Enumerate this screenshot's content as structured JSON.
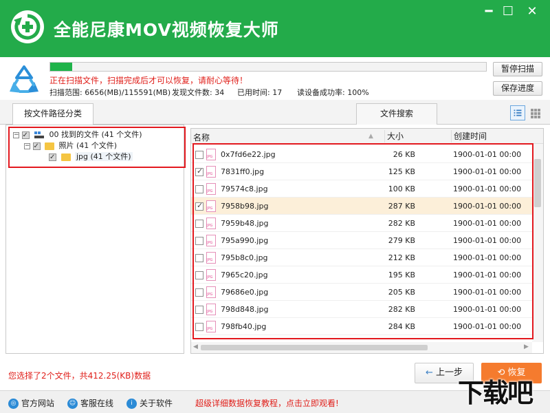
{
  "app": {
    "title": "全能尼康MOV视频恢复大师",
    "window_controls": {
      "minimize": "━",
      "maximize": "☐",
      "close": "✕"
    }
  },
  "scan": {
    "progress": 0.05,
    "status": "正在扫描文件，扫描完成后才可以恢复，请耐心等待！",
    "range": "扫描范围: 6656(MB)/115591(MB)",
    "found": "发现文件数: 34",
    "elapsed": "已用时间: 17",
    "read_rate": "读设备成功率: 100%",
    "pause_label": "暂停扫描",
    "save_label": "保存进度"
  },
  "tabs": {
    "by_path": "按文件路径分类",
    "search": "文件搜索"
  },
  "tree": [
    {
      "label": "00 找到的文件 (41 个文件)"
    },
    {
      "label": "照片   (41 个文件)"
    },
    {
      "label": "jpg   (41 个文件)"
    }
  ],
  "list": {
    "headers": {
      "name": "名称",
      "size": "大小",
      "created": "创建时间"
    },
    "rows": [
      {
        "name": "0x7fd6e22.jpg",
        "size": "26 KB",
        "created": "1900-01-01  00:00",
        "checked": false
      },
      {
        "name": "7831ff0.jpg",
        "size": "125 KB",
        "created": "1900-01-01  00:00",
        "checked": true
      },
      {
        "name": "79574c8.jpg",
        "size": "100 KB",
        "created": "1900-01-01  00:00",
        "checked": false
      },
      {
        "name": "7958b98.jpg",
        "size": "287 KB",
        "created": "1900-01-01  00:00",
        "checked": true
      },
      {
        "name": "7959b48.jpg",
        "size": "282 KB",
        "created": "1900-01-01  00:00",
        "checked": false
      },
      {
        "name": "795a990.jpg",
        "size": "279 KB",
        "created": "1900-01-01  00:00",
        "checked": false
      },
      {
        "name": "795b8c0.jpg",
        "size": "212 KB",
        "created": "1900-01-01  00:00",
        "checked": false
      },
      {
        "name": "7965c20.jpg",
        "size": "195 KB",
        "created": "1900-01-01  00:00",
        "checked": false
      },
      {
        "name": "79686e0.jpg",
        "size": "205 KB",
        "created": "1900-01-01  00:00",
        "checked": false
      },
      {
        "name": "798d848.jpg",
        "size": "282 KB",
        "created": "1900-01-01  00:00",
        "checked": false
      },
      {
        "name": "798fb40.jpg",
        "size": "284 KB",
        "created": "1900-01-01  00:00",
        "checked": false
      }
    ],
    "selected_row": 3
  },
  "footer": {
    "selection_summary": "您选择了2个文件，共412.25(KB)数据",
    "prev_label": "上一步",
    "recover_label": "恢复",
    "links": [
      "官方网站",
      "客服在线",
      "关于软件"
    ],
    "promo": "超级详细数据恢复教程，点击立即观看!",
    "watermark": "下载吧"
  },
  "colors": {
    "brand_green": "#23ab4a",
    "alert_red": "#e0201b",
    "recover_orange": "#f57b2e",
    "highlight_red": "#e3181e"
  },
  "icons": [
    "app-logo-icon",
    "recycle-scan-icon",
    "folder-icon",
    "jpg-file-icon",
    "list-view-icon",
    "grid-view-icon",
    "globe-icon",
    "chat-icon",
    "info-icon"
  ]
}
